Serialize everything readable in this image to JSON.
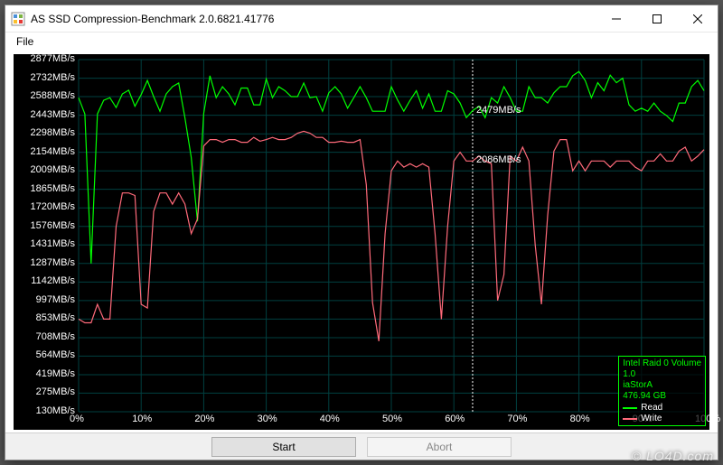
{
  "window": {
    "title": "AS SSD Compression-Benchmark 2.0.6821.41776",
    "minimize": "–",
    "maximize": "☐",
    "close": "✕"
  },
  "menu": {
    "file": "File"
  },
  "buttons": {
    "start": "Start",
    "abort": "Abort"
  },
  "watermark": "© LO4D.com",
  "chart_data": {
    "type": "line",
    "xlabel_ticks": [
      "0%",
      "10%",
      "20%",
      "30%",
      "40%",
      "50%",
      "60%",
      "70%",
      "80%",
      "90%",
      "100%"
    ],
    "y_ticks": [
      2877,
      2732,
      2588,
      2443,
      2298,
      2154,
      2009,
      1865,
      1720,
      1576,
      1431,
      1287,
      1142,
      997,
      853,
      708,
      564,
      419,
      275,
      130
    ],
    "y_tick_unit": "MB/s",
    "ylim": [
      130,
      2877
    ],
    "xlim": [
      0,
      100
    ],
    "cursor_x": 63,
    "cursor_labels": {
      "read": "2479MB/s",
      "write": "2086MB/s"
    },
    "series": [
      {
        "name": "Read",
        "color": "#00ff00",
        "values": [
          [
            0,
            2580
          ],
          [
            1,
            2453
          ],
          [
            2,
            1286
          ],
          [
            3,
            2453
          ],
          [
            4,
            2559
          ],
          [
            5,
            2580
          ],
          [
            6,
            2503
          ],
          [
            7,
            2609
          ],
          [
            8,
            2638
          ],
          [
            9,
            2513
          ],
          [
            10,
            2604
          ],
          [
            11,
            2714
          ],
          [
            12,
            2588
          ],
          [
            13,
            2474
          ],
          [
            14,
            2609
          ],
          [
            15,
            2666
          ],
          [
            16,
            2694
          ],
          [
            17,
            2424
          ],
          [
            18,
            2114
          ],
          [
            19,
            1615
          ],
          [
            20,
            2456
          ],
          [
            21,
            2751
          ],
          [
            22,
            2580
          ],
          [
            23,
            2666
          ],
          [
            24,
            2609
          ],
          [
            25,
            2524
          ],
          [
            26,
            2655
          ],
          [
            27,
            2655
          ],
          [
            28,
            2524
          ],
          [
            29,
            2524
          ],
          [
            30,
            2726
          ],
          [
            31,
            2580
          ],
          [
            32,
            2666
          ],
          [
            33,
            2634
          ],
          [
            34,
            2588
          ],
          [
            35,
            2588
          ],
          [
            36,
            2694
          ],
          [
            37,
            2580
          ],
          [
            38,
            2588
          ],
          [
            39,
            2474
          ],
          [
            40,
            2618
          ],
          [
            41,
            2666
          ],
          [
            42,
            2609
          ],
          [
            43,
            2498
          ],
          [
            44,
            2580
          ],
          [
            45,
            2666
          ],
          [
            46,
            2580
          ],
          [
            47,
            2474
          ],
          [
            48,
            2474
          ],
          [
            49,
            2474
          ],
          [
            50,
            2666
          ],
          [
            51,
            2562
          ],
          [
            52,
            2474
          ],
          [
            53,
            2559
          ],
          [
            54,
            2634
          ],
          [
            55,
            2498
          ],
          [
            56,
            2609
          ],
          [
            57,
            2474
          ],
          [
            58,
            2474
          ],
          [
            59,
            2634
          ],
          [
            60,
            2609
          ],
          [
            61,
            2538
          ],
          [
            62,
            2424
          ],
          [
            63,
            2479
          ],
          [
            64,
            2513
          ],
          [
            65,
            2424
          ],
          [
            66,
            2580
          ],
          [
            67,
            2538
          ],
          [
            68,
            2666
          ],
          [
            69,
            2580
          ],
          [
            70,
            2474
          ],
          [
            71,
            2474
          ],
          [
            72,
            2666
          ],
          [
            73,
            2580
          ],
          [
            74,
            2580
          ],
          [
            75,
            2538
          ],
          [
            76,
            2618
          ],
          [
            77,
            2666
          ],
          [
            78,
            2666
          ],
          [
            79,
            2751
          ],
          [
            80,
            2784
          ],
          [
            81,
            2714
          ],
          [
            82,
            2580
          ],
          [
            83,
            2697
          ],
          [
            84,
            2634
          ],
          [
            85,
            2755
          ],
          [
            86,
            2697
          ],
          [
            87,
            2732
          ],
          [
            88,
            2524
          ],
          [
            89,
            2474
          ],
          [
            90,
            2498
          ],
          [
            91,
            2474
          ],
          [
            92,
            2538
          ],
          [
            93,
            2474
          ],
          [
            94,
            2440
          ],
          [
            95,
            2394
          ],
          [
            96,
            2538
          ],
          [
            97,
            2538
          ],
          [
            98,
            2666
          ],
          [
            99,
            2714
          ],
          [
            100,
            2634
          ]
        ]
      },
      {
        "name": "Write",
        "color": "#ff6a7a",
        "values": [
          [
            0,
            853
          ],
          [
            1,
            824
          ],
          [
            2,
            824
          ],
          [
            3,
            968
          ],
          [
            4,
            853
          ],
          [
            5,
            853
          ],
          [
            6,
            1576
          ],
          [
            7,
            1837
          ],
          [
            8,
            1837
          ],
          [
            9,
            1817
          ],
          [
            10,
            968
          ],
          [
            11,
            939
          ],
          [
            12,
            1692
          ],
          [
            13,
            1837
          ],
          [
            14,
            1837
          ],
          [
            15,
            1749
          ],
          [
            16,
            1837
          ],
          [
            17,
            1750
          ],
          [
            18,
            1519
          ],
          [
            19,
            1634
          ],
          [
            20,
            2203
          ],
          [
            21,
            2253
          ],
          [
            22,
            2253
          ],
          [
            23,
            2232
          ],
          [
            24,
            2253
          ],
          [
            25,
            2253
          ],
          [
            26,
            2232
          ],
          [
            27,
            2232
          ],
          [
            28,
            2270
          ],
          [
            29,
            2240
          ],
          [
            30,
            2253
          ],
          [
            31,
            2270
          ],
          [
            32,
            2253
          ],
          [
            33,
            2253
          ],
          [
            34,
            2270
          ],
          [
            35,
            2303
          ],
          [
            36,
            2318
          ],
          [
            37,
            2303
          ],
          [
            38,
            2270
          ],
          [
            39,
            2270
          ],
          [
            40,
            2232
          ],
          [
            41,
            2232
          ],
          [
            42,
            2240
          ],
          [
            43,
            2232
          ],
          [
            44,
            2232
          ],
          [
            45,
            2253
          ],
          [
            46,
            1902
          ],
          [
            47,
            982
          ],
          [
            48,
            680
          ],
          [
            49,
            1519
          ],
          [
            50,
            2009
          ],
          [
            51,
            2086
          ],
          [
            52,
            2038
          ],
          [
            53,
            2065
          ],
          [
            54,
            2038
          ],
          [
            55,
            2065
          ],
          [
            56,
            2038
          ],
          [
            57,
            1519
          ],
          [
            58,
            853
          ],
          [
            59,
            1576
          ],
          [
            60,
            2086
          ],
          [
            61,
            2154
          ],
          [
            62,
            2086
          ],
          [
            63,
            2086
          ],
          [
            64,
            2124
          ],
          [
            65,
            2086
          ],
          [
            66,
            2065
          ],
          [
            67,
            997
          ],
          [
            68,
            1200
          ],
          [
            69,
            2124
          ],
          [
            70,
            2086
          ],
          [
            71,
            2194
          ],
          [
            72,
            2086
          ],
          [
            73,
            1431
          ],
          [
            74,
            968
          ],
          [
            75,
            1663
          ],
          [
            76,
            2163
          ],
          [
            77,
            2253
          ],
          [
            78,
            2253
          ],
          [
            79,
            2009
          ],
          [
            80,
            2086
          ],
          [
            81,
            2009
          ],
          [
            82,
            2086
          ],
          [
            83,
            2086
          ],
          [
            84,
            2086
          ],
          [
            85,
            2038
          ],
          [
            86,
            2086
          ],
          [
            87,
            2086
          ],
          [
            88,
            2086
          ],
          [
            89,
            2038
          ],
          [
            90,
            2009
          ],
          [
            91,
            2086
          ],
          [
            92,
            2086
          ],
          [
            93,
            2142
          ],
          [
            94,
            2086
          ],
          [
            95,
            2086
          ],
          [
            96,
            2163
          ],
          [
            97,
            2194
          ],
          [
            98,
            2086
          ],
          [
            99,
            2124
          ],
          [
            100,
            2175
          ]
        ]
      }
    ],
    "legend": {
      "device": "Intel Raid 0 Volume",
      "version": "1.0",
      "driver": "iaStorA",
      "size": "476.94 GB"
    }
  }
}
